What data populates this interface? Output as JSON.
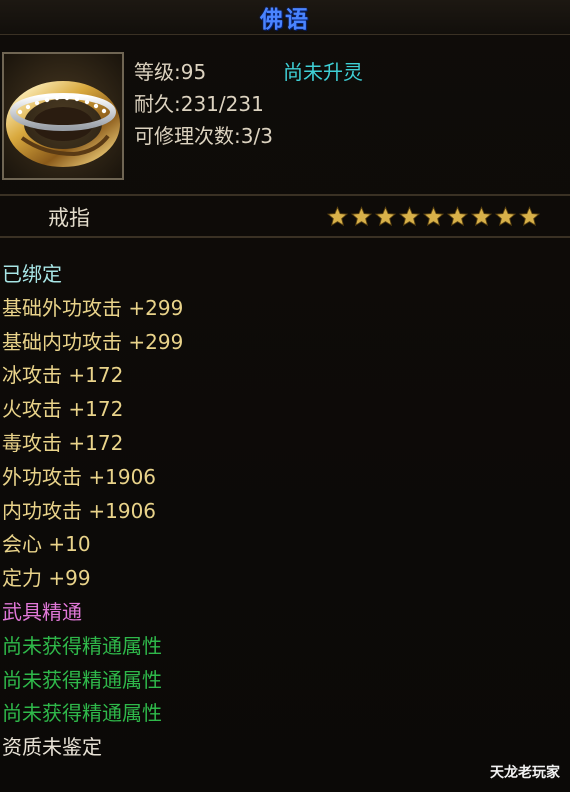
{
  "title": "佛语",
  "header": {
    "level": "等级:95",
    "ascension": "尚未升灵",
    "durability": "耐久:231/231",
    "repair": "可修理次数:3/3"
  },
  "item_type": "戒指",
  "star_count": 9,
  "colors": {
    "title": "#4a84ff",
    "ascension": "#3fd0d6",
    "attribute": "#e9d38a",
    "bound": "#a8e6e6",
    "mastery": "#e078d8",
    "mastery_missing": "#2fb84a",
    "star": "#d8b14a"
  },
  "attributes": [
    {
      "text": "已绑定",
      "style": "cyan"
    },
    {
      "text": "基础外功攻击 +299",
      "style": "gold"
    },
    {
      "text": "基础内功攻击 +299",
      "style": "gold"
    },
    {
      "text": "冰攻击 +172",
      "style": "gold"
    },
    {
      "text": "火攻击 +172",
      "style": "gold"
    },
    {
      "text": "毒攻击 +172",
      "style": "gold"
    },
    {
      "text": "外功攻击 +1906",
      "style": "gold"
    },
    {
      "text": "内功攻击 +1906",
      "style": "gold"
    },
    {
      "text": "会心 +10",
      "style": "gold"
    },
    {
      "text": "定力 +99",
      "style": "gold"
    },
    {
      "text": "武具精通",
      "style": "pink"
    },
    {
      "text": "尚未获得精通属性",
      "style": "green"
    },
    {
      "text": "尚未获得精通属性",
      "style": "green"
    },
    {
      "text": "尚未获得精通属性",
      "style": "green"
    },
    {
      "text": "资质未鉴定",
      "style": "white"
    }
  ],
  "watermark": "天龙老玩家",
  "icon": "ring-icon"
}
